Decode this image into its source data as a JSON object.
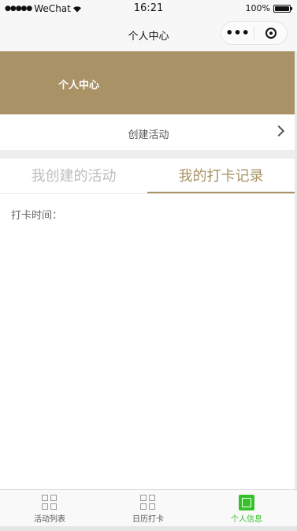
{
  "status_bar": {
    "signal": "●●●●●",
    "carrier": "WeChat",
    "time": "16:21",
    "battery": "100%"
  },
  "nav": {
    "title": "个人中心",
    "more": "•••"
  },
  "banner": {
    "title": "个人中心",
    "background": "#a99266"
  },
  "create_row": {
    "label": "创建活动"
  },
  "tabs": [
    {
      "label": "我创建的活动",
      "active": false
    },
    {
      "label": "我的打卡记录",
      "active": true
    }
  ],
  "content": {
    "checkin_time_label": "打卡时间："
  },
  "tab_bar": {
    "items": [
      {
        "label": "活动列表",
        "icon": "grid-icon",
        "active": false
      },
      {
        "label": "日历打卡",
        "icon": "grid-icon",
        "active": false
      },
      {
        "label": "个人信息",
        "icon": "user-icon",
        "active": true
      }
    ],
    "active_color": "#36c12b"
  }
}
